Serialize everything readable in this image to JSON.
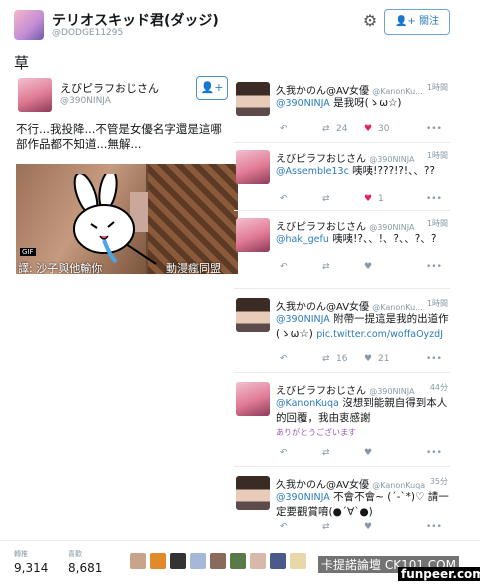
{
  "header": {
    "name": "テリオスキッド君(ダッジ)",
    "handle": "@DODGE11295",
    "follow_label": "關注"
  },
  "caption": "草",
  "left_tweet": {
    "name": "えびピラフおじさん",
    "handle": "@390NINJA",
    "text": "不行...我投降...不管是女優名字還是這哪部作品都不知道...無解...",
    "gif_label": "GIF",
    "subtitle_left": "譯: 沙子與他輸你",
    "subtitle_right": "動漫瘋同盟"
  },
  "tweets": [
    {
      "name": "久我かのん@AV女優",
      "handle": "@KanonKu...",
      "time": "1時間",
      "mention": "@390NINJA",
      "text": "是我呀(ゝω☆)",
      "retweets": "24",
      "likes": "30"
    },
    {
      "name": "えびピラフおじさん",
      "handle": "@390NINJA",
      "time": "1時間",
      "mention": "@Assemble13c",
      "text": "咦咦!???!?!、、??",
      "retweets": "",
      "likes": "1"
    },
    {
      "name": "えびピラフおじさん",
      "handle": "@390NINJA",
      "time": "1時間",
      "mention": "@hak_gefu",
      "text": "咦咦!?、、!、?、、?、?",
      "retweets": "",
      "likes": ""
    },
    {
      "name": "久我かのん@AV女優",
      "handle": "@KanonKu...",
      "time": "1時間",
      "mention": "@390NINJA",
      "text": "附帶一提這是我的出道作(ゝω☆)",
      "link": "pic.twitter.com/woffaOyzdJ",
      "retweets": "16",
      "likes": "21"
    },
    {
      "name": "えびピラフおじさん",
      "handle": "@390NINJA",
      "time": "44分",
      "mention": "@KanonKuqa",
      "text": "沒想到能親自得到本人的回覆，我由衷感謝",
      "note": "ありがとうございます",
      "retweets": "",
      "likes": ""
    },
    {
      "name": "久我かのん@AV女優",
      "handle": "@KanonKuqa",
      "time": "35分",
      "mention": "@390NINJA",
      "text": "不會不會~ (´-`*)♡ 請一定要觀賞唷(●´∀`●)",
      "retweets": "",
      "likes": ""
    }
  ],
  "footer": {
    "retweets_label": "轉推",
    "retweets_value": "9,314",
    "likes_label": "喜歡",
    "likes_value": "8,681"
  },
  "watermark": {
    "line1": "卡提諾論壇 CK101.COM",
    "line2": "funpeer.com"
  }
}
